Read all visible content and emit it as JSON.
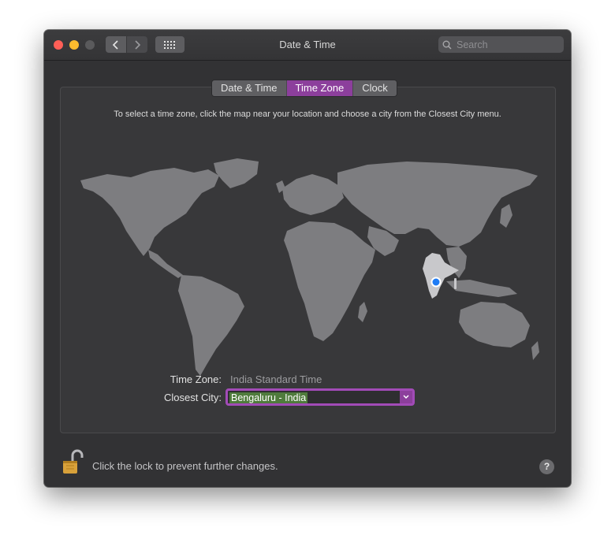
{
  "window": {
    "title": "Date & Time"
  },
  "toolbar": {
    "back_icon": "chevron-left-icon",
    "forward_icon": "chevron-right-icon",
    "show_all_icon": "grid-icon",
    "search": {
      "placeholder": "Search",
      "value": ""
    }
  },
  "tabs": [
    {
      "label": "Date & Time",
      "active": false
    },
    {
      "label": "Time Zone",
      "active": true
    },
    {
      "label": "Clock",
      "active": false
    }
  ],
  "time_zone_pane": {
    "instructions": "To select a time zone, click the map near your location and choose a city from the Closest City menu.",
    "time_zone_label": "Time Zone:",
    "time_zone_value": "India Standard Time",
    "closest_city_label": "Closest City:",
    "closest_city_value": "Bengaluru - India"
  },
  "footer": {
    "lock_text": "Click the lock to prevent further changes.",
    "help_label": "?"
  },
  "colors": {
    "accent": "#a24bb7",
    "selection": "#4f7b3c",
    "map_land": "#7d7d80",
    "highlight_region": "#c8c8cb",
    "location_pin": "#1f7cf5"
  }
}
